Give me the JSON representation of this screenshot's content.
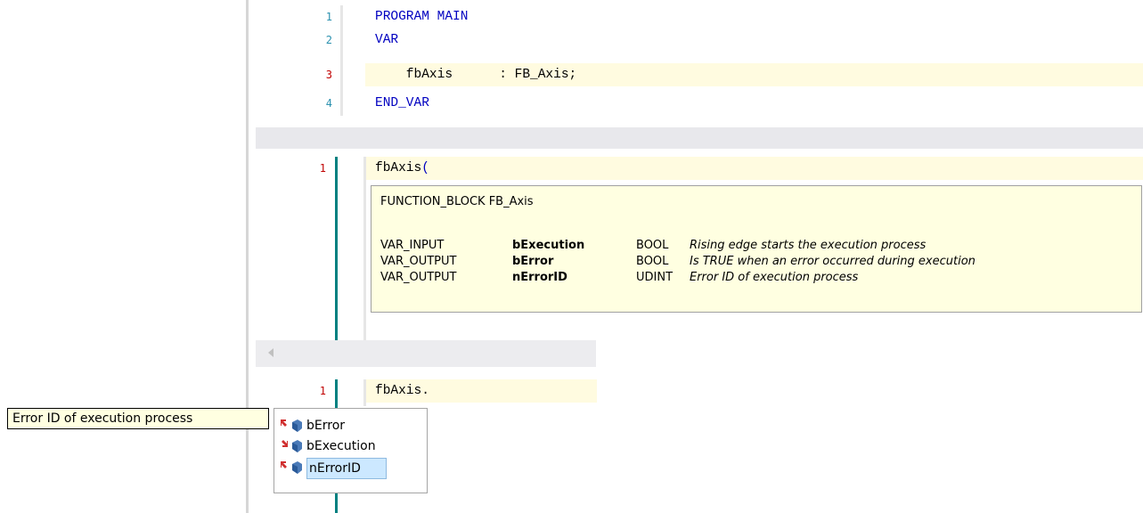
{
  "editor1": {
    "lines": [
      {
        "num": "1",
        "text": "PROGRAM MAIN"
      },
      {
        "num": "2",
        "text": "VAR"
      },
      {
        "num": "3",
        "text": "    fbAxis      : FB_Axis;"
      },
      {
        "num": "4",
        "text": "END_VAR"
      }
    ]
  },
  "editor2": {
    "line_num": "1",
    "code_name": "fbAxis",
    "code_paren": "("
  },
  "tooltip": {
    "title": "FUNCTION_BLOCK FB_Axis",
    "rows": [
      {
        "scope": "VAR_INPUT",
        "name": "bExecution",
        "type": "BOOL",
        "desc": "Rising edge starts the execution process"
      },
      {
        "scope": "VAR_OUTPUT",
        "name": "bError",
        "type": "BOOL",
        "desc": "Is TRUE when an error occurred during execution"
      },
      {
        "scope": "VAR_OUTPUT",
        "name": "nErrorID",
        "type": "UDINT",
        "desc": "Error ID of execution process"
      }
    ]
  },
  "editor3": {
    "line_num": "1",
    "code": "fbAxis."
  },
  "autocomplete": {
    "items": [
      {
        "label": "bError",
        "icon": "output-variable-icon"
      },
      {
        "label": "bExecution",
        "icon": "input-variable-icon"
      },
      {
        "label": "nErrorID",
        "icon": "output-variable-icon",
        "selected": true
      }
    ]
  },
  "side_tooltip": "Error ID of execution process",
  "colors": {
    "keyword": "#0000c0",
    "current_line": "#fffbe0",
    "line_number": "#2b91af",
    "error_line_number": "#c00000",
    "margin_teal": "#008080",
    "selection": "#cce8ff"
  }
}
